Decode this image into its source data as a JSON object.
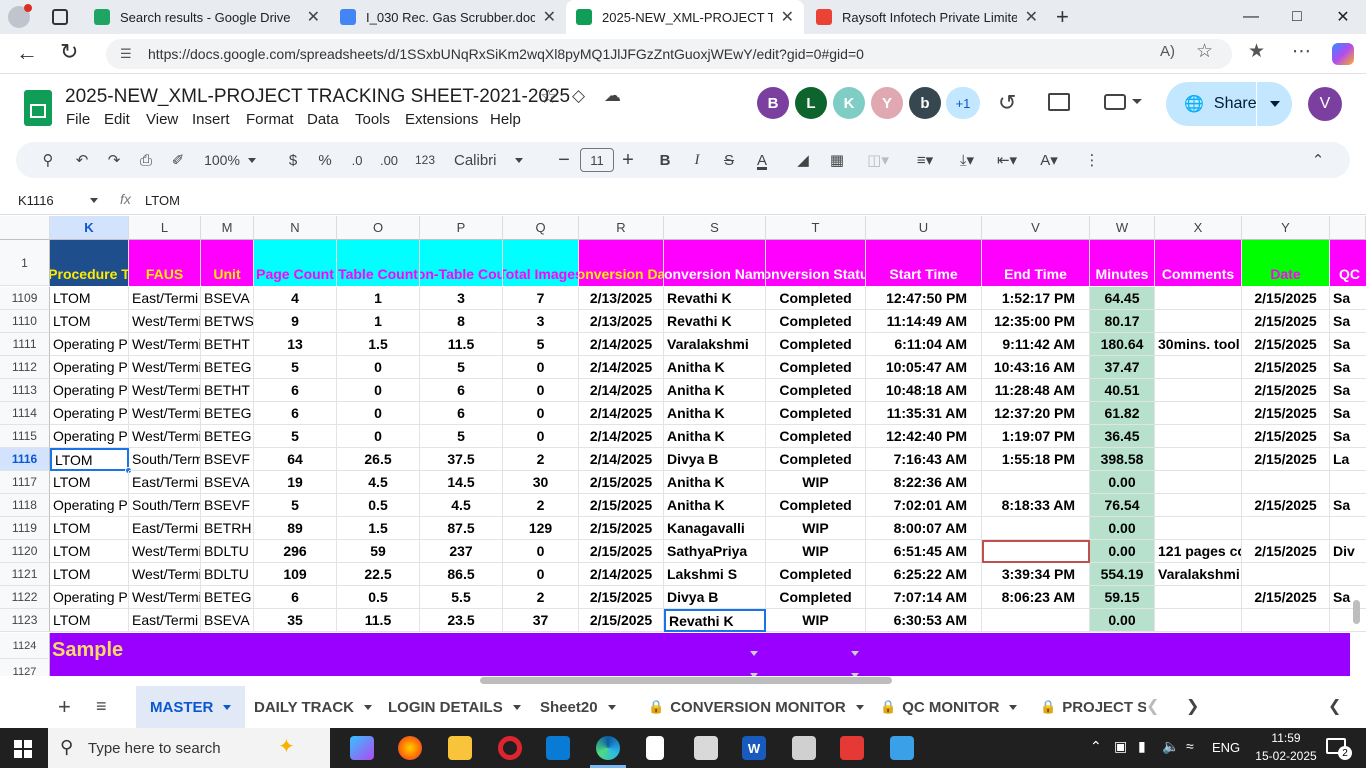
{
  "browser": {
    "tabs": [
      {
        "title": "Search results - Google Drive",
        "color": "#1fa463"
      },
      {
        "title": "I_030 Rec. Gas Scrubber.doc - Go",
        "color": "#4285f4"
      },
      {
        "title": "2025-NEW_XML-PROJECT TRACK",
        "color": "#0f9d58"
      },
      {
        "title": "Raysoft Infotech Private Limited",
        "color": "#ea4335"
      }
    ],
    "url": "https://docs.google.com/spreadsheets/d/1SSxbUNqRxSiKm2wqXl8pyMQ1JlJFGzZntGuoxjWEwY/edit?gid=0#gid=0"
  },
  "doc": {
    "title": "2025-NEW_XML-PROJECT TRACKING SHEET-2021-2025",
    "menus": [
      "File",
      "Edit",
      "View",
      "Insert",
      "Format",
      "Data",
      "Tools",
      "Extensions",
      "Help"
    ],
    "avatars": [
      {
        "letter": "B",
        "color": "#7b3fa0"
      },
      {
        "letter": "L",
        "color": "#0d652d"
      },
      {
        "letter": "K",
        "color": "#7fcdc4"
      },
      {
        "letter": "Y",
        "color": "#e0a8b0"
      },
      {
        "letter": "b",
        "color": "#37474f"
      }
    ],
    "more_avatars": "+1",
    "share_label": "Share",
    "user_initial": "V"
  },
  "toolbar": {
    "zoom": "100%",
    "currency": "$",
    "percent": "%",
    "dec_dec": ".0",
    "dec_inc": ".00",
    "format_123": "123",
    "font": "Calibri",
    "font_size": "11",
    "bold": "B",
    "italic": "I",
    "strike": "S",
    "text_color": "A"
  },
  "formula": {
    "cell": "K1116",
    "fx": "fx",
    "value": "LTOM"
  },
  "grid": {
    "columns": [
      "K",
      "L",
      "M",
      "N",
      "O",
      "P",
      "Q",
      "R",
      "S",
      "T",
      "U",
      "V",
      "W",
      "X",
      "Y"
    ],
    "header_row_number": "1",
    "headers": [
      "Procedure T",
      "FAUS",
      "Unit",
      "Page Count",
      "Table Count",
      "on-Table Cou",
      "Total Images",
      "onversion Da",
      "onversion Nam",
      "onversion Statu",
      "Start Time",
      "End Time",
      "Minutes",
      "Comments",
      "Date",
      "QC"
    ],
    "header_colors": {
      "K": "#1e4e8c",
      "L": "#ff00ff",
      "M": "#ff00ff",
      "N": "#00ffff",
      "O": "#00ffff",
      "P": "#00ffff",
      "Q": "#00ffff",
      "R": "#ff00ff",
      "S": "#ff00ff",
      "T": "#ff00ff",
      "U": "#ff00ff",
      "V": "#ff00ff",
      "W": "#ff00ff",
      "X": "#ff00ff",
      "Y": "#00ff00",
      "Z": "#ff00ff"
    },
    "header_text_colors": {
      "K": "#ffeb00",
      "L": "#ffeb00",
      "N": "#ff00ff",
      "R": "#ffeb00",
      "Y": "#ff00ff"
    },
    "minutes_bg": "#b7e1cd",
    "rows": [
      {
        "n": "1109",
        "K": "LTOM",
        "L": "East/Termi",
        "M": "BSEVA",
        "N": "4",
        "O": "1",
        "P": "3",
        "Q": "7",
        "R": "2/13/2025",
        "S": "Revathi K",
        "T": "Completed",
        "U": "12:47:50 PM",
        "V": "1:52:17 PM",
        "W": "64.45",
        "X": "",
        "Y": "2/15/2025",
        "Z": "Sa"
      },
      {
        "n": "1110",
        "K": "LTOM",
        "L": "West/Termi",
        "M": "BETWS",
        "N": "9",
        "O": "1",
        "P": "8",
        "Q": "3",
        "R": "2/13/2025",
        "S": "Revathi K",
        "T": "Completed",
        "U": "11:14:49 AM",
        "V": "12:35:00 PM",
        "W": "80.17",
        "X": "",
        "Y": "2/15/2025",
        "Z": "Sa"
      },
      {
        "n": "1111",
        "K": "Operating Pr",
        "L": "West/Termi",
        "M": "BETHT",
        "N": "13",
        "O": "1.5",
        "P": "11.5",
        "Q": "5",
        "R": "2/14/2025",
        "S": "Varalakshmi",
        "T": "Completed",
        "U": "6:11:04 AM",
        "V": "9:11:42 AM",
        "W": "180.64",
        "X": "30mins. tool s",
        "Y": "2/15/2025",
        "Z": "Sa"
      },
      {
        "n": "1112",
        "K": "Operating Pr",
        "L": "West/Termi",
        "M": "BETEG",
        "N": "5",
        "O": "0",
        "P": "5",
        "Q": "0",
        "R": "2/14/2025",
        "S": "Anitha K",
        "T": "Completed",
        "U": "10:05:47 AM",
        "V": "10:43:16 AM",
        "W": "37.47",
        "X": "",
        "Y": "2/15/2025",
        "Z": "Sa"
      },
      {
        "n": "1113",
        "K": "Operating Pr",
        "L": "West/Termi",
        "M": "BETHT",
        "N": "6",
        "O": "0",
        "P": "6",
        "Q": "0",
        "R": "2/14/2025",
        "S": "Anitha K",
        "T": "Completed",
        "U": "10:48:18 AM",
        "V": "11:28:48 AM",
        "W": "40.51",
        "X": "",
        "Y": "2/15/2025",
        "Z": "Sa"
      },
      {
        "n": "1114",
        "K": "Operating Pr",
        "L": "West/Termi",
        "M": "BETEG",
        "N": "6",
        "O": "0",
        "P": "6",
        "Q": "0",
        "R": "2/14/2025",
        "S": "Anitha K",
        "T": "Completed",
        "U": "11:35:31 AM",
        "V": "12:37:20 PM",
        "W": "61.82",
        "X": "",
        "Y": "2/15/2025",
        "Z": "Sa"
      },
      {
        "n": "1115",
        "K": "Operating Pr",
        "L": "West/Termi",
        "M": "BETEG",
        "N": "5",
        "O": "0",
        "P": "5",
        "Q": "0",
        "R": "2/14/2025",
        "S": "Anitha K",
        "T": "Completed",
        "U": "12:42:40 PM",
        "V": "1:19:07 PM",
        "W": "36.45",
        "X": "",
        "Y": "2/15/2025",
        "Z": "Sa"
      },
      {
        "n": "1116",
        "K": "LTOM",
        "L": "South/Term",
        "M": "BSEVF",
        "N": "64",
        "O": "26.5",
        "P": "37.5",
        "Q": "2",
        "R": "2/14/2025",
        "S": "Divya B",
        "T": "Completed",
        "U": "7:16:43 AM",
        "V": "1:55:18 PM",
        "W": "398.58",
        "X": "",
        "Y": "2/15/2025",
        "Z": "La"
      },
      {
        "n": "1117",
        "K": "LTOM",
        "L": "East/Termi",
        "M": "BSEVA",
        "N": "19",
        "O": "4.5",
        "P": "14.5",
        "Q": "30",
        "R": "2/15/2025",
        "S": "Anitha K",
        "T": "WIP",
        "U": "8:22:36 AM",
        "V": "",
        "W": "0.00",
        "X": "",
        "Y": "",
        "Z": ""
      },
      {
        "n": "1118",
        "K": "Operating Pr",
        "L": "South/Term",
        "M": "BSEVF",
        "N": "5",
        "O": "0.5",
        "P": "4.5",
        "Q": "2",
        "R": "2/15/2025",
        "S": "Anitha K",
        "T": "Completed",
        "U": "7:02:01 AM",
        "V": "8:18:33 AM",
        "W": "76.54",
        "X": "",
        "Y": "2/15/2025",
        "Z": "Sa"
      },
      {
        "n": "1119",
        "K": "LTOM",
        "L": "East/Termi",
        "M": "BETRH",
        "N": "89",
        "O": "1.5",
        "P": "87.5",
        "Q": "129",
        "R": "2/15/2025",
        "S": "Kanagavalli",
        "T": "WIP",
        "U": "8:00:07 AM",
        "V": "",
        "W": "0.00",
        "X": "",
        "Y": "",
        "Z": ""
      },
      {
        "n": "1120",
        "K": "LTOM",
        "L": "West/Termi",
        "M": "BDLTU",
        "N": "296",
        "O": "59",
        "P": "237",
        "Q": "0",
        "R": "2/15/2025",
        "S": "SathyaPriya",
        "T": "WIP",
        "U": "6:51:45 AM",
        "V": "",
        "W": "0.00",
        "X": "121 pages co",
        "Y": "2/15/2025",
        "Z": "Div"
      },
      {
        "n": "1121",
        "K": "LTOM",
        "L": "West/Termi",
        "M": "BDLTU",
        "N": "109",
        "O": "22.5",
        "P": "86.5",
        "Q": "0",
        "R": "2/14/2025",
        "S": "Lakshmi S",
        "T": "Completed",
        "U": "6:25:22 AM",
        "V": "3:39:34 PM",
        "W": "554.19",
        "X": "Varalakshmi",
        "Y": "",
        "Z": ""
      },
      {
        "n": "1122",
        "K": "Operating Pr",
        "L": "West/Termi",
        "M": "BETEG",
        "N": "6",
        "O": "0.5",
        "P": "5.5",
        "Q": "2",
        "R": "2/15/2025",
        "S": "Divya B",
        "T": "Completed",
        "U": "7:07:14 AM",
        "V": "8:06:23 AM",
        "W": "59.15",
        "X": "",
        "Y": "2/15/2025",
        "Z": "Sa"
      },
      {
        "n": "1123",
        "K": "LTOM",
        "L": "East/Termi",
        "M": "BSEVA",
        "N": "35",
        "O": "11.5",
        "P": "23.5",
        "Q": "37",
        "R": "2/15/2025",
        "S": "Revathi K",
        "T": "WIP",
        "U": "6:30:53 AM",
        "V": "",
        "W": "0.00",
        "X": "",
        "Y": "",
        "Z": ""
      }
    ],
    "sample_row_numbers": [
      "1124",
      "1127"
    ],
    "sample_label": "Sample",
    "sample_bg": "#9900ff",
    "sample_text_color": "#ffd966",
    "selected_row": "1116",
    "selected_col": "K"
  },
  "sheets": {
    "tabs": [
      "MASTER",
      "DAILY TRACK",
      "LOGIN DETAILS",
      "Sheet20",
      "CONVERSION MONITOR",
      "QC MONITOR",
      "PROJECT S"
    ],
    "active": "MASTER",
    "locked": [
      false,
      false,
      false,
      false,
      true,
      true,
      true
    ]
  },
  "taskbar": {
    "search_placeholder": "Type here to search",
    "lang": "ENG",
    "time": "11:59",
    "date": "15-02-2025",
    "notif_count": "2"
  }
}
